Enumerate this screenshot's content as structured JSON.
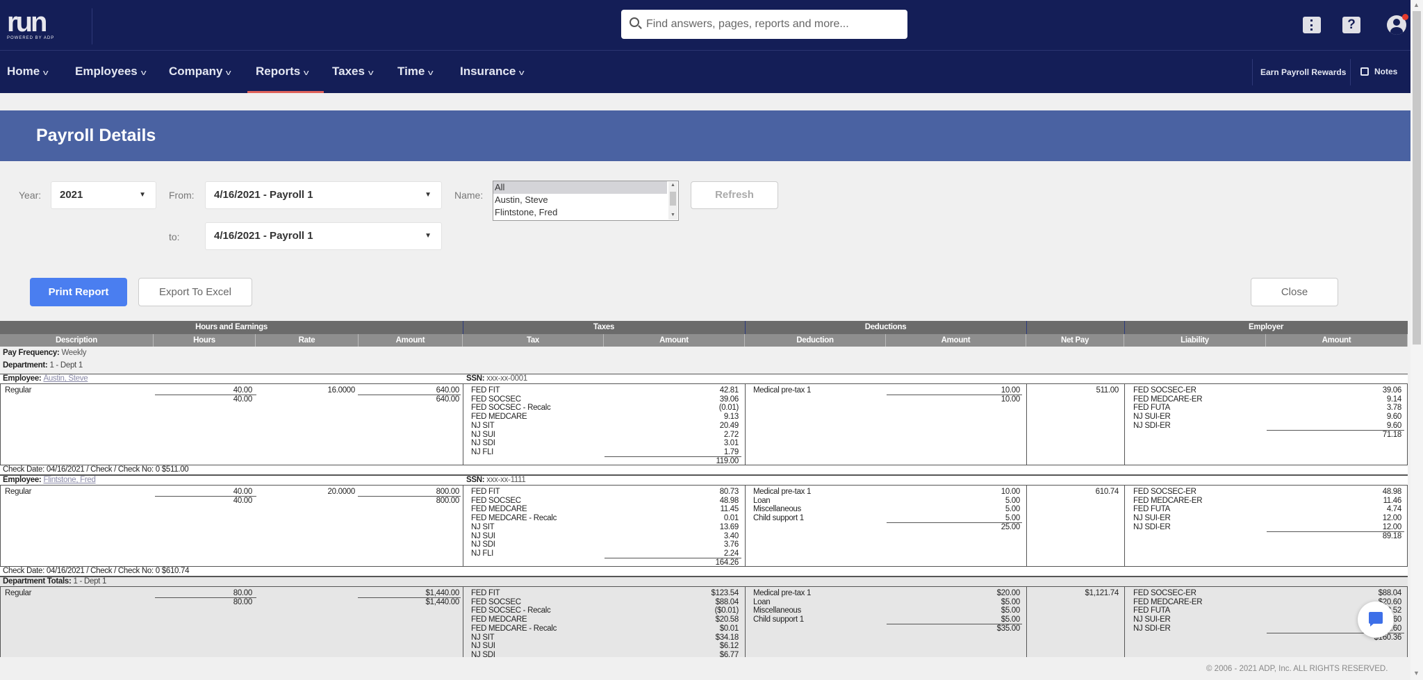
{
  "topbar": {
    "logo_text": "run",
    "logo_sub": "POWERED BY ADP",
    "search_placeholder": "Find answers, pages, reports and more...",
    "help_glyph": "?",
    "icons": [
      "search-icon",
      "ticket-icon",
      "help-icon",
      "user-icon"
    ],
    "notification_color": "#e53a2c"
  },
  "nav": {
    "items": [
      {
        "label": "Home"
      },
      {
        "label": "Employees"
      },
      {
        "label": "Company"
      },
      {
        "label": "Reports",
        "active": true
      },
      {
        "label": "Taxes"
      },
      {
        "label": "Time"
      },
      {
        "label": "Insurance"
      }
    ],
    "earn_rewards": "Earn Payroll Rewards",
    "notes": "Notes"
  },
  "page": {
    "title": "Payroll Details",
    "banner_color": "#4a62a2"
  },
  "filters": {
    "year_label": "Year:",
    "year_value": "2021",
    "from_label": "From:",
    "from_value": "4/16/2021 - Payroll 1",
    "to_label": "to:",
    "to_value": "4/16/2021 - Payroll 1",
    "name_label": "Name:",
    "name_options": [
      "All",
      "Austin, Steve",
      "Flintstone, Fred"
    ],
    "name_selected": "All",
    "refresh": "Refresh"
  },
  "actions": {
    "print": "Print Report",
    "export": "Export To Excel",
    "close": "Close",
    "primary_color": "#4a7ef0"
  },
  "report": {
    "groups": [
      "Hours and Earnings",
      "Taxes",
      "Deductions",
      "",
      "Employer"
    ],
    "columns": [
      "Description",
      "Hours",
      "Rate",
      "Amount",
      "Tax",
      "Amount",
      "Deduction",
      "Amount",
      "Net Pay",
      "Liability",
      "Amount"
    ],
    "pay_frequency_label": "Pay Frequency:",
    "pay_frequency": "Weekly",
    "department_label": "Department:",
    "department": "1 - Dept 1",
    "blocks": [
      {
        "label": "Employee:",
        "name": "Austin, Steve",
        "ssn_label": "SSN:",
        "ssn": "xxx-xx-0001",
        "earnings": [
          {
            "desc": "Regular",
            "hours": "40.00",
            "rate": "16.0000",
            "amount": "640.00"
          }
        ],
        "hours_total": "40.00",
        "amount_total": "640.00",
        "taxes": [
          {
            "name": "FED FIT",
            "amount": "42.81"
          },
          {
            "name": "FED SOCSEC",
            "amount": "39.06"
          },
          {
            "name": "FED SOCSEC - Recalc",
            "amount": "(0.01)"
          },
          {
            "name": "FED MEDCARE",
            "amount": "9.13"
          },
          {
            "name": "NJ SIT",
            "amount": "20.49"
          },
          {
            "name": "NJ SUI",
            "amount": "2.72"
          },
          {
            "name": "NJ SDI",
            "amount": "3.01"
          },
          {
            "name": "NJ FLI",
            "amount": "1.79"
          }
        ],
        "taxes_total": "119.00",
        "deductions": [
          {
            "name": "Medical pre-tax 1",
            "amount": "10.00"
          }
        ],
        "deductions_total": "10.00",
        "net_pay": "511.00",
        "liabilities": [
          {
            "name": "FED SOCSEC-ER",
            "amount": "39.06"
          },
          {
            "name": "FED MEDCARE-ER",
            "amount": "9.14"
          },
          {
            "name": "FED FUTA",
            "amount": "3.78"
          },
          {
            "name": "NJ SUI-ER",
            "amount": "9.60"
          },
          {
            "name": "NJ SDI-ER",
            "amount": "9.60"
          }
        ],
        "liabilities_total": "71.18",
        "check_line": "Check Date: 04/16/2021 / Check / Check No: 0 $511.00"
      },
      {
        "label": "Employee:",
        "name": "Flintstone, Fred",
        "ssn_label": "SSN:",
        "ssn": "xxx-xx-1111",
        "earnings": [
          {
            "desc": "Regular",
            "hours": "40.00",
            "rate": "20.0000",
            "amount": "800.00"
          }
        ],
        "hours_total": "40.00",
        "amount_total": "800.00",
        "taxes": [
          {
            "name": "FED FIT",
            "amount": "80.73"
          },
          {
            "name": "FED SOCSEC",
            "amount": "48.98"
          },
          {
            "name": "FED MEDCARE",
            "amount": "11.45"
          },
          {
            "name": "FED MEDCARE - Recalc",
            "amount": "0.01"
          },
          {
            "name": "NJ SIT",
            "amount": "13.69"
          },
          {
            "name": "NJ SUI",
            "amount": "3.40"
          },
          {
            "name": "NJ SDI",
            "amount": "3.76"
          },
          {
            "name": "NJ FLI",
            "amount": "2.24"
          }
        ],
        "taxes_total": "164.26",
        "deductions": [
          {
            "name": "Medical pre-tax 1",
            "amount": "10.00"
          },
          {
            "name": "Loan",
            "amount": "5.00"
          },
          {
            "name": "Miscellaneous",
            "amount": "5.00"
          },
          {
            "name": "Child support 1",
            "amount": "5.00"
          }
        ],
        "deductions_total": "25.00",
        "net_pay": "610.74",
        "liabilities": [
          {
            "name": "FED SOCSEC-ER",
            "amount": "48.98"
          },
          {
            "name": "FED MEDCARE-ER",
            "amount": "11.46"
          },
          {
            "name": "FED FUTA",
            "amount": "4.74"
          },
          {
            "name": "NJ SUI-ER",
            "amount": "12.00"
          },
          {
            "name": "NJ SDI-ER",
            "amount": "12.00"
          }
        ],
        "liabilities_total": "89.18",
        "check_line": "Check Date: 04/16/2021 / Check / Check No: 0 $610.74"
      }
    ],
    "dept_totals": {
      "label": "Department Totals:",
      "name": "1 - Dept 1",
      "earnings": [
        {
          "desc": "Regular",
          "hours": "80.00",
          "rate": "",
          "amount": "$1,440.00"
        }
      ],
      "hours_total": "80.00",
      "amount_total": "$1,440.00",
      "taxes": [
        {
          "name": "FED FIT",
          "amount": "$123.54"
        },
        {
          "name": "FED SOCSEC",
          "amount": "$88.04"
        },
        {
          "name": "FED SOCSEC - Recalc",
          "amount": "($0.01)"
        },
        {
          "name": "FED MEDCARE",
          "amount": "$20.58"
        },
        {
          "name": "FED MEDCARE - Recalc",
          "amount": "$0.01"
        },
        {
          "name": "NJ SIT",
          "amount": "$34.18"
        },
        {
          "name": "NJ SUI",
          "amount": "$6.12"
        },
        {
          "name": "NJ SDI",
          "amount": "$6.77"
        }
      ],
      "deductions": [
        {
          "name": "Medical pre-tax 1",
          "amount": "$20.00"
        },
        {
          "name": "Loan",
          "amount": "$5.00"
        },
        {
          "name": "Miscellaneous",
          "amount": "$5.00"
        },
        {
          "name": "Child support 1",
          "amount": "$5.00"
        }
      ],
      "deductions_total": "$35.00",
      "net_pay": "$1,121.74",
      "liabilities": [
        {
          "name": "FED SOCSEC-ER",
          "amount": "$88.04"
        },
        {
          "name": "FED MEDCARE-ER",
          "amount": "$20.60"
        },
        {
          "name": "FED FUTA",
          "amount": "$8.52"
        },
        {
          "name": "NJ SUI-ER",
          "amount": "$21.60"
        },
        {
          "name": "NJ SDI-ER",
          "amount": "$21.60"
        }
      ],
      "liabilities_total": "$160.36"
    }
  },
  "footer": {
    "copyright": "© 2006 - 2021 ADP, Inc. ALL RIGHTS RESERVED."
  }
}
